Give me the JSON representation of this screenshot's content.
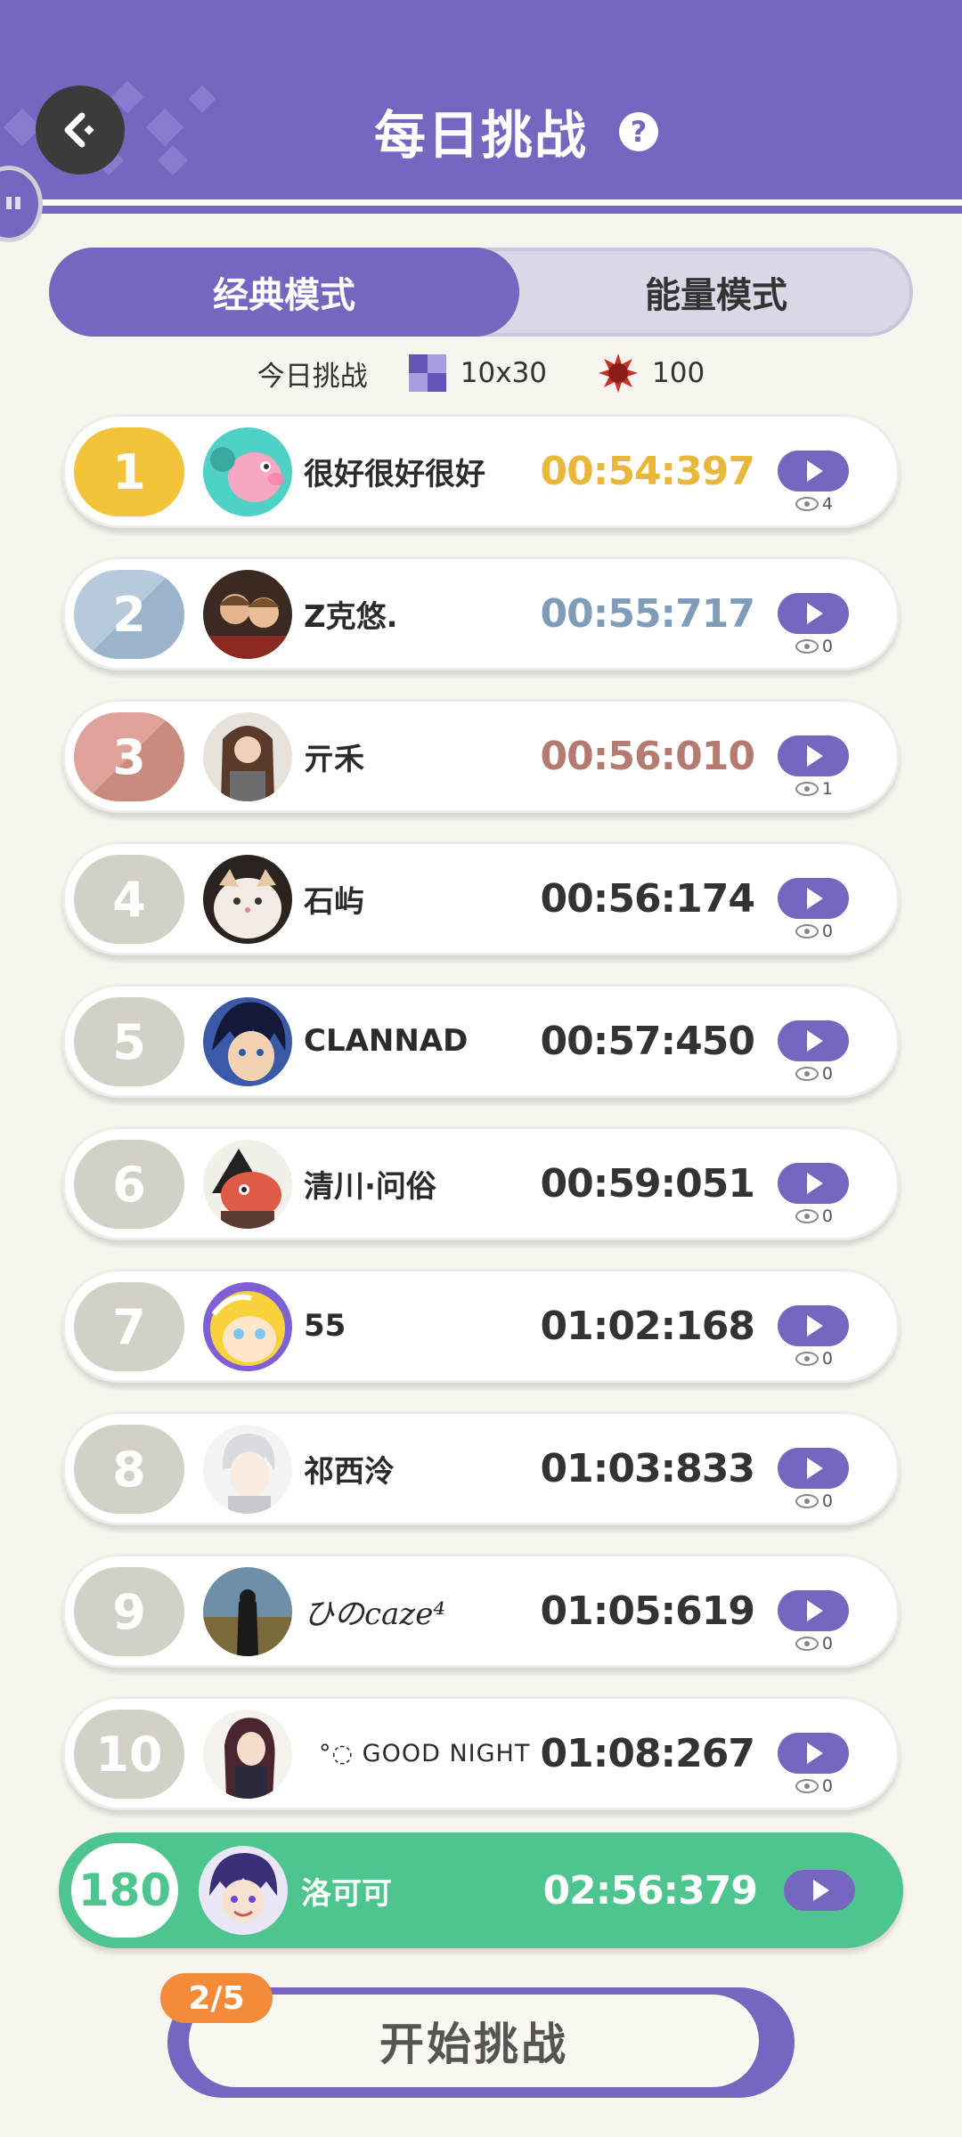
{
  "header": {
    "title": "每日挑战",
    "help": "?"
  },
  "tabs": {
    "classic": "经典模式",
    "energy": "能量模式"
  },
  "challenge_info": {
    "label": "今日挑战",
    "grid_size": "10x30",
    "mines": "100"
  },
  "leaderboard": [
    {
      "rank": "1",
      "name": "很好很好很好",
      "time": "00:54:397",
      "views": "4"
    },
    {
      "rank": "2",
      "name": "Z克悠.",
      "time": "00:55:717",
      "views": "0"
    },
    {
      "rank": "3",
      "name": "亓禾",
      "time": "00:56:010",
      "views": "1"
    },
    {
      "rank": "4",
      "name": "石屿",
      "time": "00:56:174",
      "views": "0"
    },
    {
      "rank": "5",
      "name": "CLANNAD",
      "time": "00:57:450",
      "views": "0"
    },
    {
      "rank": "6",
      "name": "清川·问俗",
      "time": "00:59:051",
      "views": "0"
    },
    {
      "rank": "7",
      "name": "55",
      "time": "01:02:168",
      "views": "0"
    },
    {
      "rank": "8",
      "name": "祁西泠",
      "time": "01:03:833",
      "views": "0"
    },
    {
      "rank": "9",
      "name": "ひのcaze⁴",
      "time": "01:05:619",
      "views": "0"
    },
    {
      "rank": "10",
      "name": "°◌ GOOD NIGHT",
      "time": "01:08:267",
      "views": "0"
    }
  ],
  "my_entry": {
    "rank": "180",
    "name": "洛可可",
    "time": "02:56:379"
  },
  "start": {
    "attempts": "2/5",
    "label": "开始挑战"
  },
  "colors": {
    "accent": "#7766c0",
    "gold": "#f3c43a",
    "silver": "#9bb4cb",
    "bronze": "#c98a7f",
    "me": "#4ec48e",
    "badge": "#f38b3a"
  }
}
